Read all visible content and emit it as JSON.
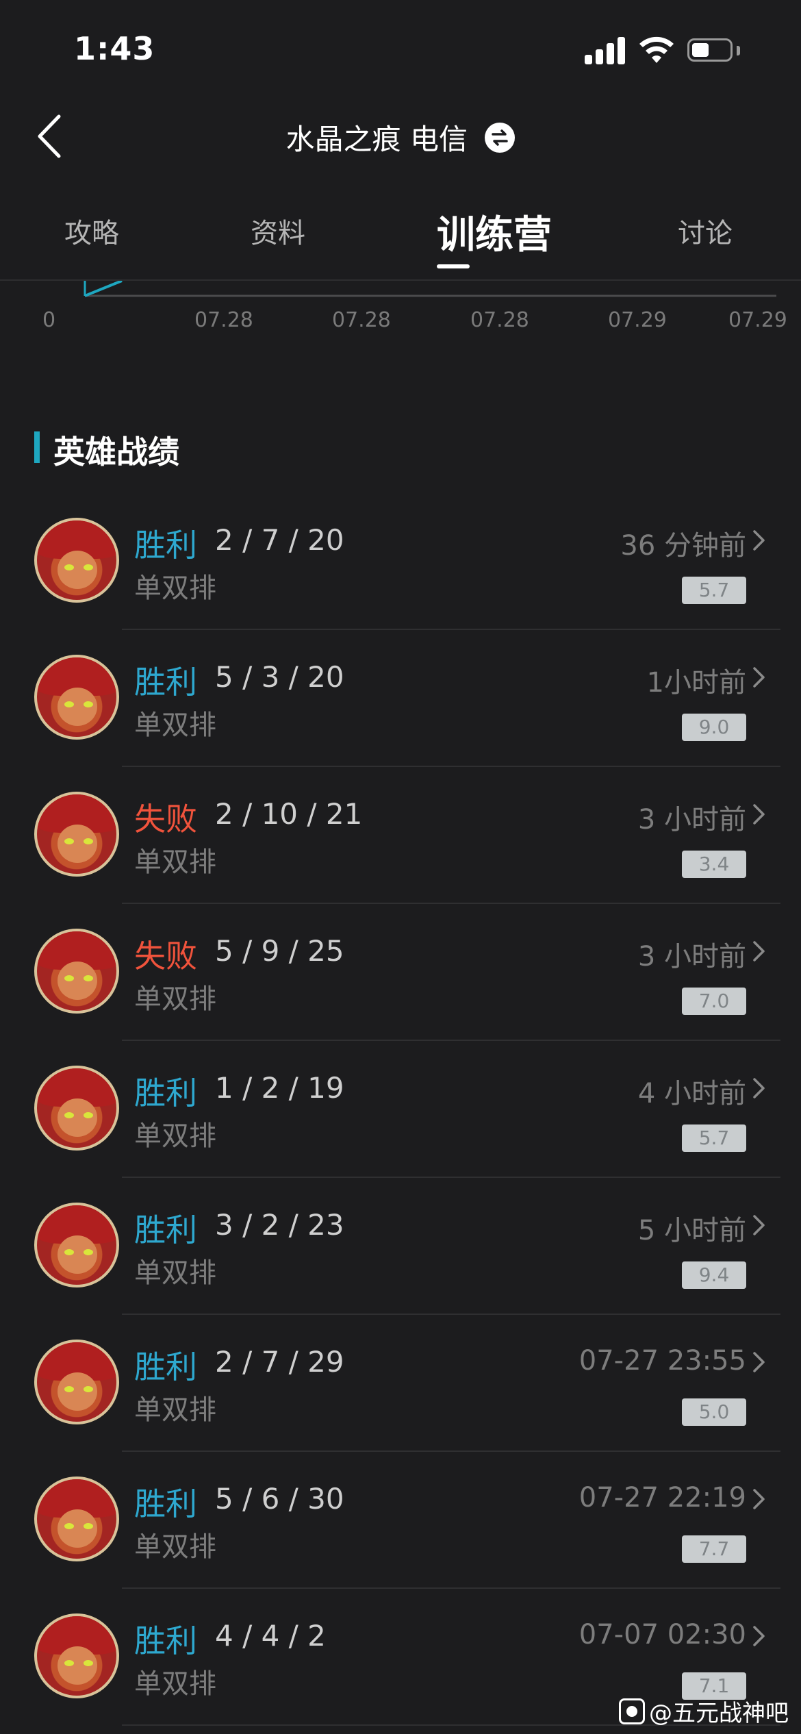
{
  "status_bar": {
    "time": "1:43"
  },
  "nav": {
    "title": "水晶之痕 电信"
  },
  "tabs": [
    {
      "label": "攻略",
      "active": false
    },
    {
      "label": "资料",
      "active": false
    },
    {
      "label": "训练营",
      "active": true
    },
    {
      "label": "讨论",
      "active": false
    }
  ],
  "chart_data": {
    "type": "line",
    "x_tick_labels": [
      "0",
      "07.28",
      "07.28",
      "07.28",
      "07.29",
      "07.29"
    ],
    "series_color": "#1ea7c0"
  },
  "section": {
    "title": "英雄战绩"
  },
  "matches": [
    {
      "result": "胜利",
      "outcome": "win",
      "kda": "2 / 7 / 20",
      "mode": "单双排",
      "time": "36 分钟前",
      "score": "5.7"
    },
    {
      "result": "胜利",
      "outcome": "win",
      "kda": "5 / 3 / 20",
      "mode": "单双排",
      "time": "1小时前",
      "score": "9.0"
    },
    {
      "result": "失败",
      "outcome": "loss",
      "kda": "2 / 10 / 21",
      "mode": "单双排",
      "time": "3 小时前",
      "score": "3.4"
    },
    {
      "result": "失败",
      "outcome": "loss",
      "kda": "5 / 9 / 25",
      "mode": "单双排",
      "time": "3 小时前",
      "score": "7.0"
    },
    {
      "result": "胜利",
      "outcome": "win",
      "kda": "1 / 2 / 19",
      "mode": "单双排",
      "time": "4 小时前",
      "score": "5.7"
    },
    {
      "result": "胜利",
      "outcome": "win",
      "kda": "3 / 2 / 23",
      "mode": "单双排",
      "time": "5 小时前",
      "score": "9.4"
    },
    {
      "result": "胜利",
      "outcome": "win",
      "kda": "2 / 7 / 29",
      "mode": "单双排",
      "time": "07-27 23:55",
      "score": "5.0"
    },
    {
      "result": "胜利",
      "outcome": "win",
      "kda": "5 / 6 / 30",
      "mode": "单双排",
      "time": "07-27 22:19",
      "score": "7.7"
    },
    {
      "result": "胜利",
      "outcome": "win",
      "kda": "4 / 4 / 2",
      "mode": "单双排",
      "time": "07-07 02:30",
      "score": "7.1"
    }
  ],
  "watermark": {
    "text": "@五元战神吧"
  },
  "colors": {
    "win": "#2ea8cf",
    "loss": "#f0533c",
    "accent": "#1ea7c0",
    "background": "#1c1c1e"
  },
  "icons": [
    "signal-icon",
    "wifi-icon",
    "battery-icon",
    "back-icon",
    "swap-icon",
    "chevron-icon",
    "paw-icon"
  ]
}
